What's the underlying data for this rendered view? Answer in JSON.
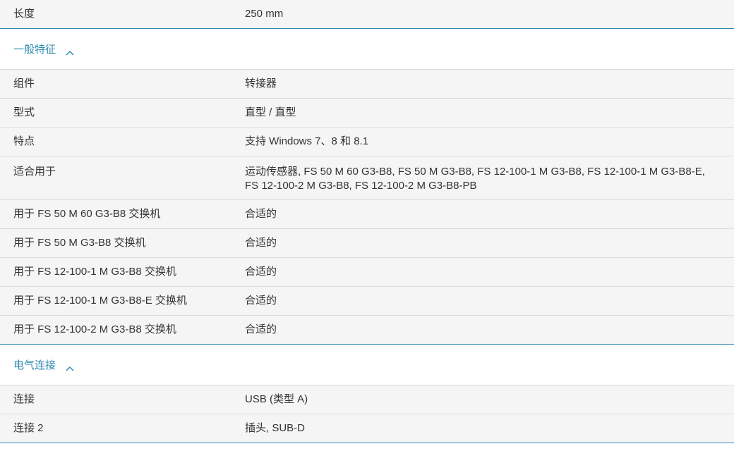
{
  "top": {
    "label": "长度",
    "value": "250 mm"
  },
  "sections": [
    {
      "title": "一般特征",
      "rows": [
        {
          "label": "组件",
          "value": "转接器"
        },
        {
          "label": "型式",
          "value": "直型 / 直型"
        },
        {
          "label": "特点",
          "value": "支持 Windows 7、8 和 8.1"
        },
        {
          "label": "适合用于",
          "value": "运动传感器, FS 50 M 60 G3-B8, FS 50 M G3-B8, FS 12-100-1 M G3-B8, FS 12-100-1 M G3-B8-E, FS 12-100-2 M G3-B8, FS 12-100-2 M G3-B8-PB"
        },
        {
          "label": "用于 FS 50 M 60 G3-B8 交换机",
          "value": "合适的"
        },
        {
          "label": "用于 FS 50 M G3-B8 交换机",
          "value": "合适的"
        },
        {
          "label": "用于 FS 12-100-1 M G3-B8 交换机",
          "value": "合适的"
        },
        {
          "label": "用于 FS 12-100-1 M G3-B8-E 交换机",
          "value": "合适的"
        },
        {
          "label": "用于 FS 12-100-2 M G3-B8 交换机",
          "value": "合适的"
        }
      ]
    },
    {
      "title": "电气连接",
      "rows": [
        {
          "label": "连接",
          "value": "USB (类型 A)"
        },
        {
          "label": "连接 2",
          "value": "插头, SUB-D"
        }
      ]
    }
  ],
  "icons": {
    "section_toggle": "chevron-up-icon"
  },
  "colors": {
    "accent": "#2d8ab0",
    "row_bg": "#f5f5f5",
    "divider": "#dcdcdc",
    "text": "#333333"
  }
}
